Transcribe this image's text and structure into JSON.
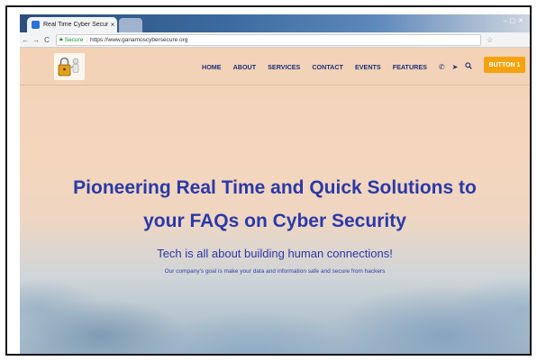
{
  "browser": {
    "tab_title": "Real Time Cyber Security",
    "tab_close": "×",
    "secure_label": "Secure",
    "url": "https://www.ganamoscybersecure.org"
  },
  "nav": {
    "items": [
      "HOME",
      "ABOUT",
      "SERVICES",
      "CONTACT",
      "EVENTS",
      "FEATURES"
    ],
    "icons": [
      "phone-icon",
      "send-icon",
      "search-icon"
    ],
    "button_label": "BUTTON 1"
  },
  "hero": {
    "title_line1": "Pioneering Real Time and Quick Solutions to",
    "title_line2": "your FAQs on Cyber Security",
    "subtitle": "Tech is all about building human connections!",
    "tagline": "Our company's goal is make your data and information safe and secure from hackers"
  },
  "colors": {
    "accent_button": "#f5a30c",
    "nav_text": "#1c2f7a",
    "hero_text": "#2c39a8"
  }
}
